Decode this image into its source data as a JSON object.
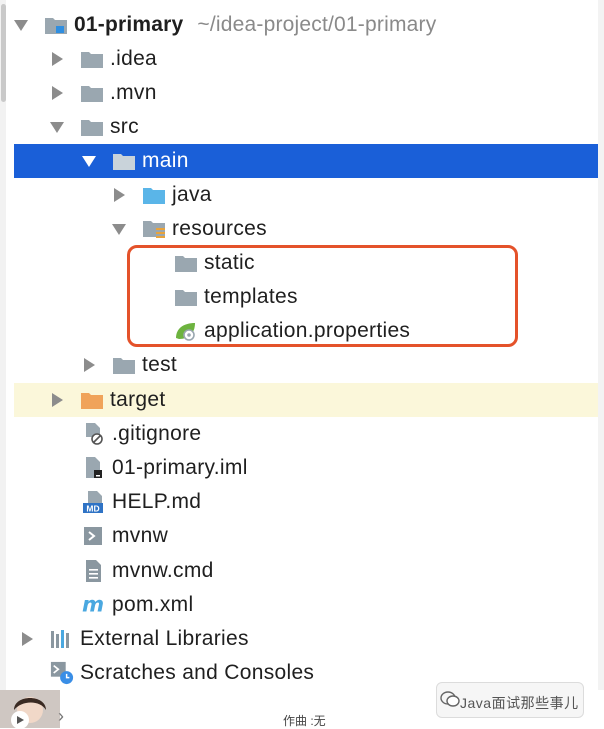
{
  "project_tree": {
    "root": {
      "name": "01-primary",
      "path": "~/idea-project/01-primary"
    },
    "nodes": [
      {
        "label": ".idea",
        "icon": "folder-icon"
      },
      {
        "label": ".mvn",
        "icon": "folder-icon"
      },
      {
        "label": "src",
        "icon": "folder-icon"
      },
      {
        "label": "main",
        "icon": "source-folder-icon",
        "selected": true
      },
      {
        "label": "java",
        "icon": "java-source-folder-icon"
      },
      {
        "label": "resources",
        "icon": "resources-folder-icon"
      },
      {
        "label": "static",
        "icon": "folder-icon"
      },
      {
        "label": "templates",
        "icon": "folder-icon"
      },
      {
        "label": "application.properties",
        "icon": "spring-properties-icon"
      },
      {
        "label": "test",
        "icon": "folder-icon"
      },
      {
        "label": "target",
        "icon": "excluded-folder-icon"
      },
      {
        "label": ".gitignore",
        "icon": "ignore-file-icon"
      },
      {
        "label": "01-primary.iml",
        "icon": "iml-file-icon"
      },
      {
        "label": "HELP.md",
        "icon": "markdown-file-icon",
        "badge": "MD"
      },
      {
        "label": "mvnw",
        "icon": "shell-script-icon"
      },
      {
        "label": "mvnw.cmd",
        "icon": "text-file-icon"
      },
      {
        "label": "pom.xml",
        "icon": "maven-icon",
        "badge": "m"
      }
    ],
    "external_libraries": "External Libraries",
    "scratches": "Scratches and Consoles"
  },
  "footer": {
    "caption": "作曲 :无",
    "watermark": "Java面试那些事儿"
  },
  "colors": {
    "selection": "#1a5fd8",
    "highlight_border": "#e4522a",
    "excluded_bg": "#fbf7da",
    "folder": "#9aa7b0",
    "java_folder": "#5ab5e8",
    "target_folder": "#f0a35a",
    "spring_green": "#6db33f"
  }
}
